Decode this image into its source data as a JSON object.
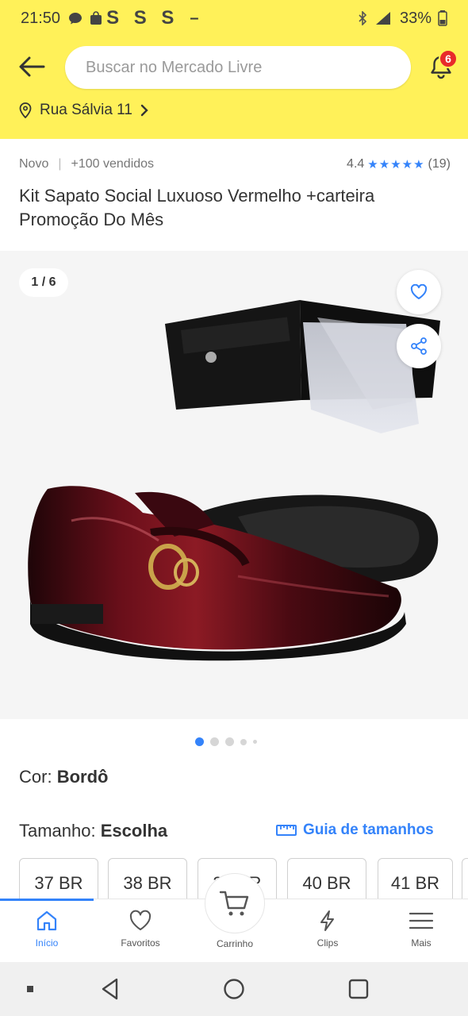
{
  "status_bar": {
    "time": "21:50",
    "letters": "S S S",
    "battery": "33%"
  },
  "header": {
    "search_placeholder": "Buscar no Mercado Livre",
    "notifications_count": "6",
    "address": "Rua Sálvia 11"
  },
  "product": {
    "condition": "Novo",
    "sold": "+100 vendidos",
    "rating": "4.4",
    "stars": "★★★★★",
    "reviews": "(19)",
    "title": "Kit Sapato Social Luxuoso Vermelho +carteira Promoção Do Mês"
  },
  "gallery": {
    "counter": "1 / 6",
    "dots": 5,
    "active_dot": 1
  },
  "variations": {
    "color_label": "Cor:",
    "color_value": "Bordô",
    "size_label": "Tamanho:",
    "size_value": "Escolha",
    "size_guide": "Guia de tamanhos",
    "sizes": [
      "37 BR",
      "38 BR",
      "39 BR",
      "40 BR",
      "41 BR"
    ]
  },
  "bottom_nav": {
    "items": [
      {
        "label": "Início",
        "icon": "home-icon",
        "active": true
      },
      {
        "label": "Favoritos",
        "icon": "heart-icon",
        "active": false
      },
      {
        "label": "Carrinho",
        "icon": "cart-icon",
        "active": false
      },
      {
        "label": "Clips",
        "icon": "lightning-icon",
        "active": false
      },
      {
        "label": "Mais",
        "icon": "menu-icon",
        "active": false
      }
    ]
  },
  "colors": {
    "header_yellow": "#fff159",
    "accent_blue": "#3483fa",
    "badge_red": "#e82a2a"
  }
}
